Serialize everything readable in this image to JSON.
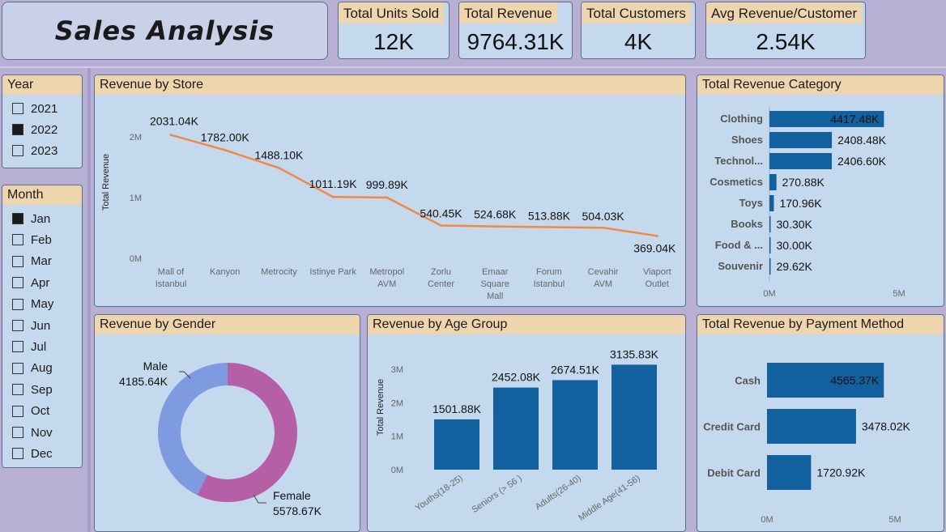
{
  "title": "Sales Analysis",
  "kpis": [
    {
      "label": "Total Units Sold",
      "value": "12K"
    },
    {
      "label": "Total Revenue",
      "value": "9764.31K"
    },
    {
      "label": "Total Customers",
      "value": "4K"
    },
    {
      "label": "Avg Revenue/Customer",
      "value": "2.54K"
    }
  ],
  "year_slicer": {
    "title": "Year",
    "items": [
      {
        "label": "2021",
        "checked": false
      },
      {
        "label": "2022",
        "checked": true
      },
      {
        "label": "2023",
        "checked": false
      }
    ]
  },
  "month_slicer": {
    "title": "Month",
    "items": [
      {
        "label": "Jan",
        "checked": true
      },
      {
        "label": "Feb",
        "checked": false
      },
      {
        "label": "Mar",
        "checked": false
      },
      {
        "label": "Apr",
        "checked": false
      },
      {
        "label": "May",
        "checked": false
      },
      {
        "label": "Jun",
        "checked": false
      },
      {
        "label": "Jul",
        "checked": false
      },
      {
        "label": "Aug",
        "checked": false
      },
      {
        "label": "Sep",
        "checked": false
      },
      {
        "label": "Oct",
        "checked": false
      },
      {
        "label": "Nov",
        "checked": false
      },
      {
        "label": "Dec",
        "checked": false
      }
    ]
  },
  "colors": {
    "bar": "#12609e",
    "line": "#ee8a45",
    "male": "#7f9be0",
    "female": "#b45fa6"
  },
  "chart_data": [
    {
      "id": "store",
      "type": "line",
      "title": "Revenue by Store",
      "ylabel": "Total Revenue",
      "categories": [
        [
          "Mall of",
          "Istanbul"
        ],
        [
          "Kanyon"
        ],
        [
          "Metrocity"
        ],
        [
          "Istinye Park"
        ],
        [
          "Metropol",
          "AVM"
        ],
        [
          "Zorlu",
          "Center"
        ],
        [
          "Emaar",
          "Square",
          "Mall"
        ],
        [
          "Forum",
          "Istanbul"
        ],
        [
          "Cevahir",
          "AVM"
        ],
        [
          "Viaport",
          "Outlet"
        ]
      ],
      "values": [
        2031.04,
        1782.0,
        1488.1,
        1011.19,
        999.89,
        540.45,
        524.68,
        513.88,
        504.03,
        369.04
      ],
      "labels": [
        "2031.04K",
        "1782.00K",
        "1488.10K",
        "1011.19K",
        "999.89K",
        "540.45K",
        "524.68K",
        "513.88K",
        "504.03K",
        "369.04K"
      ],
      "yticks": [
        "0M",
        "1M",
        "2M"
      ],
      "ylim": [
        0,
        2200
      ]
    },
    {
      "id": "category",
      "type": "bar",
      "orientation": "horizontal",
      "title": "Total Revenue Category",
      "categories": [
        "Clothing",
        "Shoes",
        "Technol...",
        "Cosmetics",
        "Toys",
        "Books",
        "Food & ...",
        "Souvenir"
      ],
      "values": [
        4417.48,
        2408.48,
        2406.6,
        270.88,
        170.96,
        30.3,
        30.0,
        29.62
      ],
      "labels": [
        "4417.48K",
        "2408.48K",
        "2406.60K",
        "270.88K",
        "170.96K",
        "30.30K",
        "30.00K",
        "29.62K"
      ],
      "xticks": [
        "0M",
        "5M"
      ],
      "xlim": [
        0,
        5000
      ]
    },
    {
      "id": "gender",
      "type": "pie",
      "title": "Revenue by Gender",
      "categories": [
        "Male",
        "Female"
      ],
      "values": [
        4185.64,
        5578.67
      ],
      "labels": [
        "4185.64K",
        "5578.67K"
      ]
    },
    {
      "id": "age",
      "type": "bar",
      "title": "Revenue by Age Group",
      "ylabel": "Total Revenue",
      "categories": [
        "Youths(18-25)",
        "Seniors (> 56 )",
        "Adults(26-40)",
        "Middle Age(41-56)"
      ],
      "values": [
        1501.88,
        2452.08,
        2674.51,
        3135.83
      ],
      "labels": [
        "1501.88K",
        "2452.08K",
        "2674.51K",
        "3135.83K"
      ],
      "yticks": [
        "0M",
        "1M",
        "2M",
        "3M"
      ],
      "ylim": [
        0,
        3000
      ]
    },
    {
      "id": "payment",
      "type": "bar",
      "orientation": "horizontal",
      "title": "Total Revenue by Payment Method",
      "categories": [
        "Cash",
        "Credit Card",
        "Debit Card"
      ],
      "values": [
        4565.37,
        3478.02,
        1720.92
      ],
      "labels": [
        "4565.37K",
        "3478.02K",
        "1720.92K"
      ],
      "xticks": [
        "0M",
        "5M"
      ],
      "xlim": [
        0,
        5000
      ]
    }
  ]
}
